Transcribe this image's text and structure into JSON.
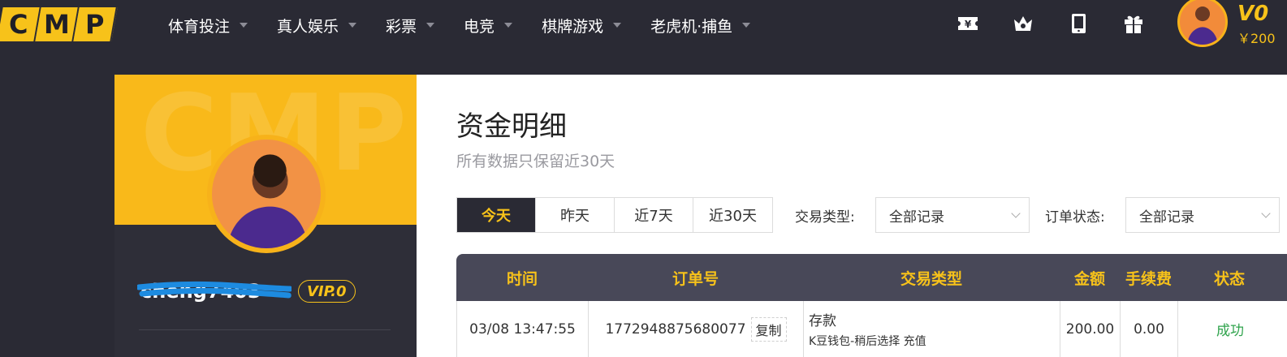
{
  "header": {
    "logo_letters": [
      "C",
      "M",
      "P"
    ],
    "nav": [
      {
        "label": "体育投注"
      },
      {
        "label": "真人娱乐"
      },
      {
        "label": "彩票"
      },
      {
        "label": "电竞"
      },
      {
        "label": "棋牌游戏"
      },
      {
        "label": "老虎机·捕鱼"
      }
    ],
    "icons": [
      "yen-ticket-icon",
      "crown-icon",
      "tablet-icon",
      "gift-icon"
    ],
    "vip_label": "V0",
    "balance": "￥200"
  },
  "profile": {
    "watermark": "CMP",
    "username": "cheng7403",
    "vip_badge": "VIP.0"
  },
  "main": {
    "title": "资金明细",
    "subtitle": "所有数据只保留近30天",
    "date_tabs": [
      {
        "label": "今天",
        "active": true
      },
      {
        "label": "昨天",
        "active": false
      },
      {
        "label": "近7天",
        "active": false
      },
      {
        "label": "近30天",
        "active": false
      }
    ],
    "filters": {
      "type_label": "交易类型:",
      "type_value": "全部记录",
      "status_label": "订单状态:",
      "status_value": "全部记录"
    },
    "table": {
      "headers": [
        "时间",
        "订单号",
        "交易类型",
        "金额",
        "手续费",
        "状态"
      ],
      "rows": [
        {
          "time": "03/08 13:47:55",
          "order_no": "1772948875680077",
          "copy_label": "复制",
          "type_main": "存款",
          "type_sub": "K豆钱包-稍后选择 充值",
          "amount": "200.00",
          "fee": "0.00",
          "status": "成功"
        }
      ]
    }
  },
  "colors": {
    "accent": "#f7c21a",
    "header_bg": "#2a2a34",
    "table_head_bg": "#484858",
    "success": "#2fa34c"
  }
}
